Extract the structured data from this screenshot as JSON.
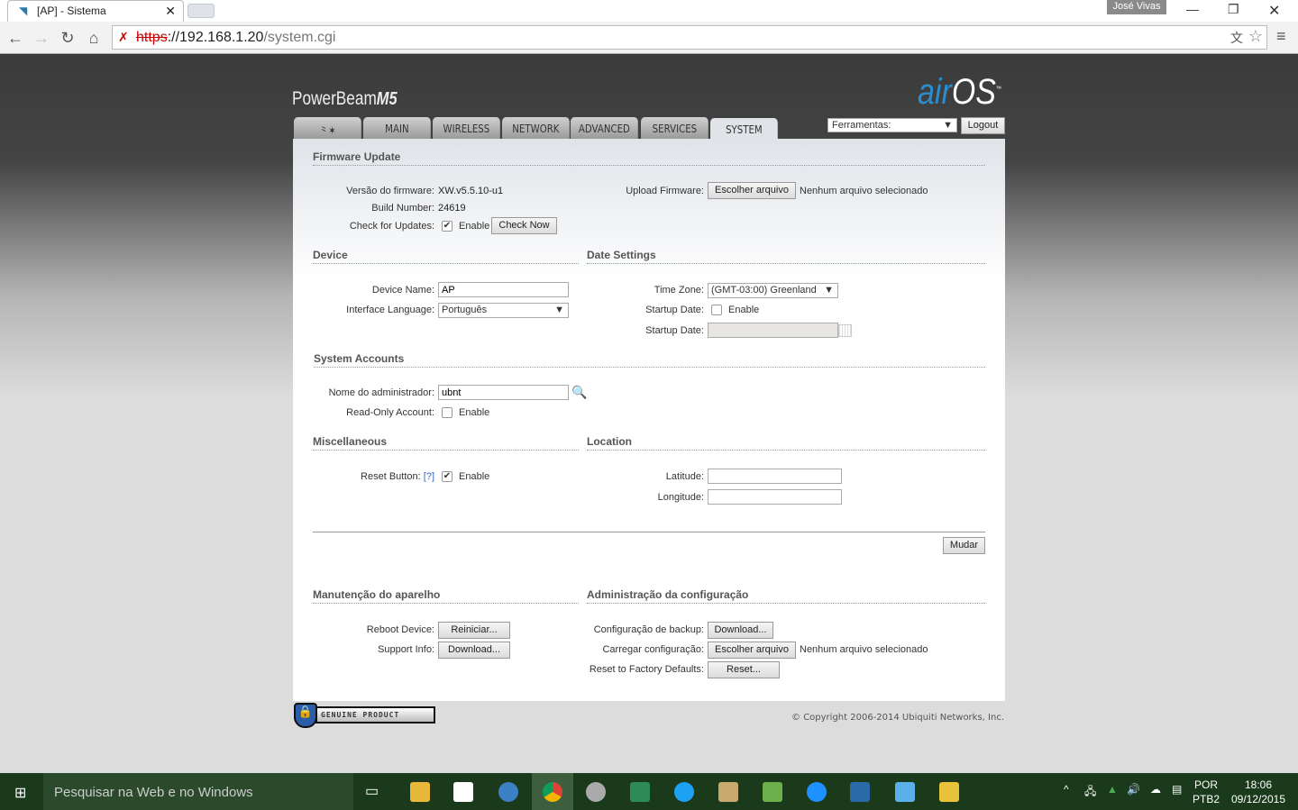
{
  "browser": {
    "tab_title": "[AP] - Sistema",
    "url_scheme": "https",
    "url_host": "://192.168.1.20",
    "url_path": "/system.cgi",
    "user": "José Vivas"
  },
  "header": {
    "product": "PowerBeam",
    "model": "M5",
    "brand": "airOS",
    "tools_select": "Ferramentas:",
    "logout": "Logout"
  },
  "tabs": [
    {
      "label": ""
    },
    {
      "label": "MAIN"
    },
    {
      "label": "WIRELESS"
    },
    {
      "label": "NETWORK"
    },
    {
      "label": "ADVANCED"
    },
    {
      "label": "SERVICES"
    },
    {
      "label": "SYSTEM"
    }
  ],
  "firmware": {
    "title": "Firmware Update",
    "version_label": "Versão do firmware:",
    "version": "XW.v5.5.10-u1",
    "build_label": "Build Number:",
    "build": "24619",
    "check_label": "Check for Updates:",
    "enable": "Enable",
    "check_now": "Check Now",
    "upload_label": "Upload Firmware:",
    "choose_file": "Escolher arquivo",
    "no_file": "Nenhum arquivo selecionado"
  },
  "device": {
    "title": "Device",
    "name_label": "Device Name:",
    "name": "AP",
    "lang_label": "Interface Language:",
    "lang": "Português"
  },
  "date": {
    "title": "Date Settings",
    "tz_label": "Time Zone:",
    "tz": "(GMT-03:00) Greenland",
    "startup_label": "Startup Date:",
    "enable": "Enable",
    "startup_date_label": "Startup Date:"
  },
  "accounts": {
    "title": "System Accounts",
    "admin_label": "Nome do administrador:",
    "admin": "ubnt",
    "ro_label": "Read-Only Account:",
    "enable": "Enable"
  },
  "misc": {
    "title": "Miscellaneous",
    "reset_label": "Reset Button:",
    "help": "[?]",
    "enable": "Enable"
  },
  "location": {
    "title": "Location",
    "lat_label": "Latitude:",
    "lon_label": "Longitude:"
  },
  "change_button": "Mudar",
  "maint": {
    "title": "Manutenção do aparelho",
    "reboot_label": "Reboot Device:",
    "reboot": "Reiniciar...",
    "support_label": "Support Info:",
    "download": "Download..."
  },
  "config": {
    "title": "Administração da configuração",
    "backup_label": "Configuração de backup:",
    "download": "Download...",
    "load_label": "Carregar configuração:",
    "choose_file": "Escolher arquivo",
    "no_file": "Nenhum arquivo selecionado",
    "reset_label": "Reset to Factory Defaults:",
    "reset": "Reset..."
  },
  "footer": {
    "badge": "GENUINE PRODUCT",
    "copyright": "© Copyright 2006-2014 Ubiquiti Networks, Inc."
  },
  "taskbar": {
    "search": "Pesquisar na Web e no Windows",
    "lang1": "POR",
    "lang2": "PTB2",
    "time": "18:06",
    "date": "09/12/2015"
  }
}
